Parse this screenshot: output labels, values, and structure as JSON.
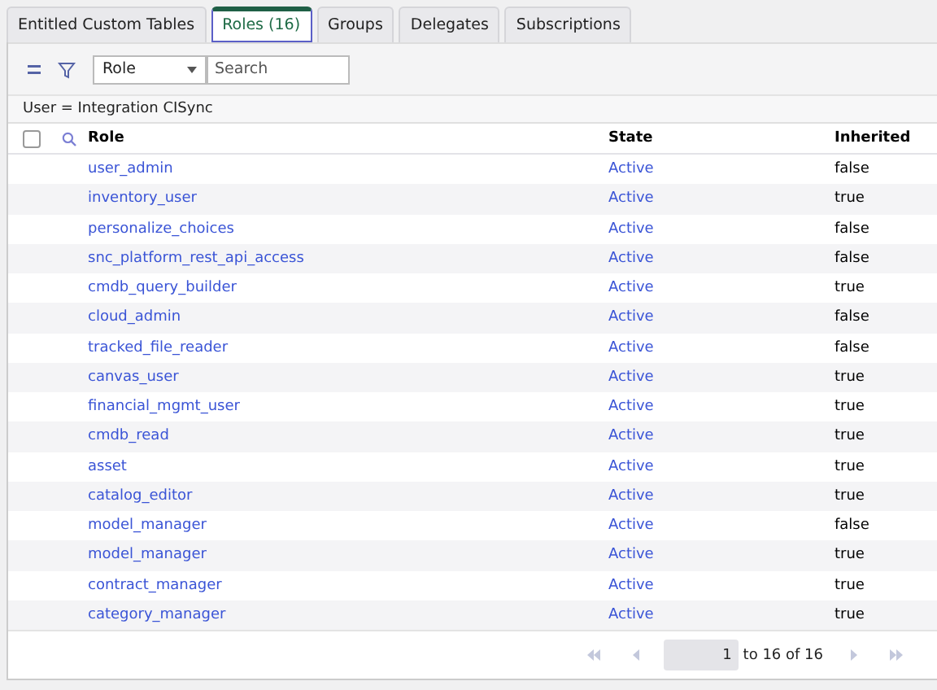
{
  "tabs": [
    {
      "label": "Entitled Custom Tables",
      "selected": false
    },
    {
      "label": "Roles (16)",
      "selected": true
    },
    {
      "label": "Groups",
      "selected": false
    },
    {
      "label": "Delegates",
      "selected": false
    },
    {
      "label": "Subscriptions",
      "selected": false
    }
  ],
  "toolbar": {
    "field_select": "Role",
    "search": {
      "placeholder": "Search"
    }
  },
  "filter": "User = Integration CISync",
  "table": {
    "select_all_checked": false,
    "columns": [
      "Role",
      "State",
      "Inherited"
    ],
    "rows": [
      [
        "user_admin",
        "Active",
        "false"
      ],
      [
        "inventory_user",
        "Active",
        "true"
      ],
      [
        "personalize_choices",
        "Active",
        "false"
      ],
      [
        "snc_platform_rest_api_access",
        "Active",
        "false"
      ],
      [
        "cmdb_query_builder",
        "Active",
        "true"
      ],
      [
        "cloud_admin",
        "Active",
        "false"
      ],
      [
        "tracked_file_reader",
        "Active",
        "false"
      ],
      [
        "canvas_user",
        "Active",
        "true"
      ],
      [
        "financial_mgmt_user",
        "Active",
        "true"
      ],
      [
        "cmdb_read",
        "Active",
        "true"
      ],
      [
        "asset",
        "Active",
        "true"
      ],
      [
        "catalog_editor",
        "Active",
        "true"
      ],
      [
        "model_manager",
        "Active",
        "false"
      ],
      [
        "model_manager",
        "Active",
        "true"
      ],
      [
        "contract_manager",
        "Active",
        "true"
      ],
      [
        "category_manager",
        "Active",
        "true"
      ]
    ]
  },
  "pagination": {
    "page": "1",
    "range": "to 16 of 16"
  }
}
